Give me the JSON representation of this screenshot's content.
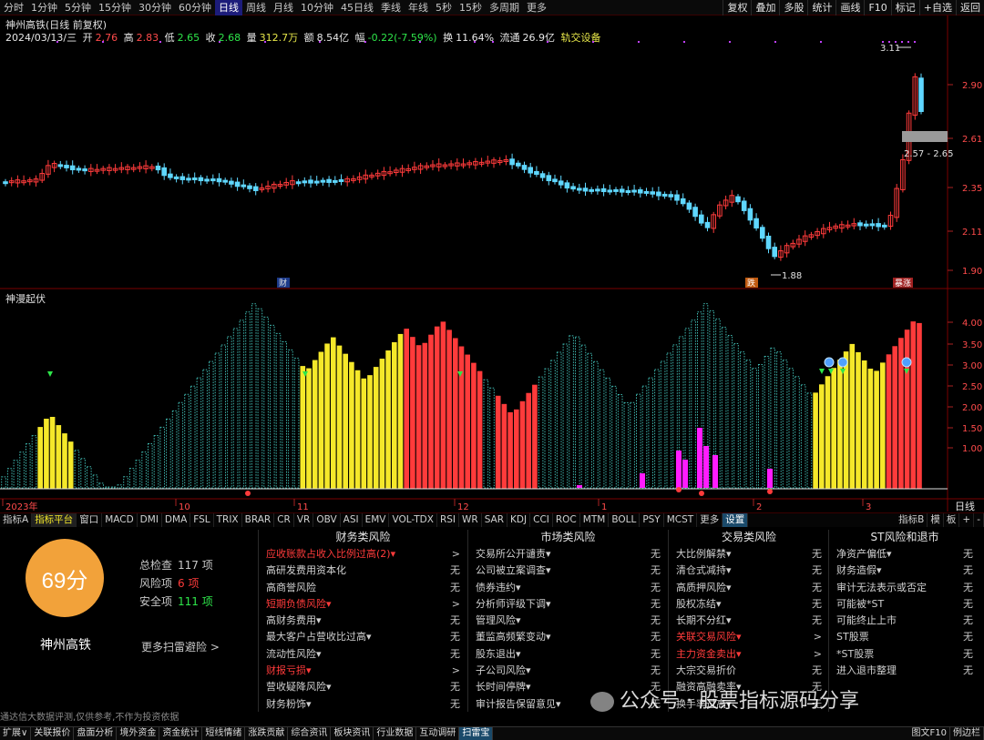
{
  "toolbar": {
    "timeframes": [
      "分时",
      "1分钟",
      "5分钟",
      "15分钟",
      "30分钟",
      "60分钟",
      "日线",
      "周线",
      "月线",
      "10分钟",
      "45日线",
      "季线",
      "年线",
      "5秒",
      "15秒",
      "多周期",
      "更多"
    ],
    "active_timeframe": "日线",
    "right_buttons": [
      "复权",
      "叠加",
      "多股",
      "统计",
      "画线",
      "F10",
      "标记",
      "+自选",
      "返回"
    ]
  },
  "stock": {
    "title": "神州高铁(日线 前复权)",
    "date": "2024/03/13/三",
    "open_label": "开",
    "open": "2.76",
    "high_label": "高",
    "high": "2.83",
    "low_label": "低",
    "low": "2.65",
    "close_label": "收",
    "close": "2.68",
    "vol_label": "量",
    "volume": "312.7万",
    "amt_label": "额",
    "amount": "8.54亿",
    "chg_label": "幅",
    "change": "-0.22(-7.59%)",
    "turn_label": "换",
    "turnover": "11.64%",
    "float_label": "流通",
    "float_cap": "26.9亿",
    "sector": "轨交设备"
  },
  "price_axis": [
    "2.90",
    "2.61",
    "2.35",
    "2.11",
    "1.90"
  ],
  "annotations": {
    "high_mark": "3.11",
    "low_mark": "1.88",
    "range_box": "2.57 - 2.65",
    "cai": "财",
    "tag_mid": "跌",
    "tag_right": "暴涨"
  },
  "indicator": {
    "title": "神漫起伏",
    "axis": [
      "4.00",
      "3.50",
      "3.00",
      "2.50",
      "2.00",
      "1.50",
      "1.00"
    ]
  },
  "time_axis": [
    "2023年",
    "10",
    "11",
    "12",
    "1",
    "2",
    "3"
  ],
  "right_corner": {
    "label": "日线"
  },
  "indicator_tabs": [
    "指标A",
    "指标平台",
    "窗口",
    "MACD",
    "DMI",
    "DMA",
    "FSL",
    "TRIX",
    "BRAR",
    "CR",
    "VR",
    "OBV",
    "ASI",
    "EMV",
    "VOL-TDX",
    "RSI",
    "WR",
    "SAR",
    "KDJ",
    "CCI",
    "ROC",
    "MTM",
    "BOLL",
    "PSY",
    "MCST",
    "更多",
    "设置"
  ],
  "indicator_tabs_right": [
    "指标B",
    "模",
    "板",
    "+",
    "-"
  ],
  "risk": {
    "score": "69分",
    "stock_name": "神州高铁",
    "total_label": "总检查",
    "total": "117 项",
    "risk_label": "风险项",
    "risk_count": "6 项",
    "safe_label": "安全项",
    "safe_count": "111 项",
    "more": "更多扫雷避险 >",
    "disclaimer": "通达信大数据评测,仅供参考,不作为投资依据",
    "columns": [
      {
        "title": "财务类风险",
        "items": [
          {
            "label": "应收账款占收入比例过高(2)▾",
            "value": ">",
            "warn": true
          },
          {
            "label": "高研发费用资本化",
            "value": "无",
            "warn": false
          },
          {
            "label": "高商誉风险",
            "value": "无",
            "warn": false
          },
          {
            "label": "短期负债风险▾",
            "value": ">",
            "warn": true
          },
          {
            "label": "高财务费用▾",
            "value": "无",
            "warn": false
          },
          {
            "label": "最大客户占营收比过高▾",
            "value": "无",
            "warn": false
          },
          {
            "label": "流动性风险▾",
            "value": "无",
            "warn": false
          },
          {
            "label": "财报亏损▾",
            "value": ">",
            "warn": true
          },
          {
            "label": "营收疑降风险▾",
            "value": "无",
            "warn": false
          },
          {
            "label": "财务粉饰▾",
            "value": "无",
            "warn": false
          }
        ]
      },
      {
        "title": "市场类风险",
        "items": [
          {
            "label": "交易所公开谴责▾",
            "value": "无",
            "warn": false
          },
          {
            "label": "公司被立案调查▾",
            "value": "无",
            "warn": false
          },
          {
            "label": "债券违约▾",
            "value": "无",
            "warn": false
          },
          {
            "label": "分析师评级下调▾",
            "value": "无",
            "warn": false
          },
          {
            "label": "管理风险▾",
            "value": "无",
            "warn": false
          },
          {
            "label": "董监高频繁变动▾",
            "value": "无",
            "warn": false
          },
          {
            "label": "股东退出▾",
            "value": "无",
            "warn": false
          },
          {
            "label": "子公司风险▾",
            "value": "无",
            "warn": false
          },
          {
            "label": "长时间停牌▾",
            "value": "无",
            "warn": false
          },
          {
            "label": "审计报告保留意见▾",
            "value": "无",
            "warn": false
          }
        ]
      },
      {
        "title": "交易类风险",
        "items": [
          {
            "label": "大比例解禁▾",
            "value": "无",
            "warn": false
          },
          {
            "label": "清仓式减持▾",
            "value": "无",
            "warn": false
          },
          {
            "label": "高质押风险▾",
            "value": "无",
            "warn": false
          },
          {
            "label": "股权冻结▾",
            "value": "无",
            "warn": false
          },
          {
            "label": "长期不分红▾",
            "value": "无",
            "warn": false
          },
          {
            "label": "关联交易风险▾",
            "value": ">",
            "warn": true
          },
          {
            "label": "主力资金卖出▾",
            "value": ">",
            "warn": true
          },
          {
            "label": "大宗交易折价",
            "value": "无",
            "warn": false
          },
          {
            "label": "融资高融卖率▾",
            "value": "无",
            "warn": false
          },
          {
            "label": "换手率过高▾",
            "value": "无",
            "warn": false
          }
        ]
      },
      {
        "title": "ST风险和退市",
        "items": [
          {
            "label": "净资产偏低▾",
            "value": "无",
            "warn": false
          },
          {
            "label": "财务造假▾",
            "value": "无",
            "warn": false
          },
          {
            "label": "审计无法表示或否定",
            "value": "无",
            "warn": false
          },
          {
            "label": "可能被*ST",
            "value": "无",
            "warn": false
          },
          {
            "label": "可能终止上市",
            "value": "无",
            "warn": false
          },
          {
            "label": "ST股票",
            "value": "无",
            "warn": false
          },
          {
            "label": "*ST股票",
            "value": "无",
            "warn": false
          },
          {
            "label": "进入退市整理",
            "value": "无",
            "warn": false
          }
        ]
      }
    ]
  },
  "bottom_tabs": [
    "扩展∨",
    "关联报价",
    "盘面分析",
    "境外资金",
    "资金统计",
    "短线情绪",
    "涨跌贡献",
    "综合资讯",
    "板块资讯",
    "行业数据",
    "互动调研",
    "扫雷宝"
  ],
  "bottom_active": "扫雷宝",
  "bottom_right": [
    "图文F10",
    "例边栏"
  ],
  "watermark": "公众号 · 股票指标源码分享",
  "colors": {
    "up": "#ff3b3b",
    "down": "#5fd7ff",
    "yellow": "#f5e82a",
    "magenta": "#ff1cff",
    "teal": "#3fb8b0",
    "score": "#f2a23a"
  }
}
